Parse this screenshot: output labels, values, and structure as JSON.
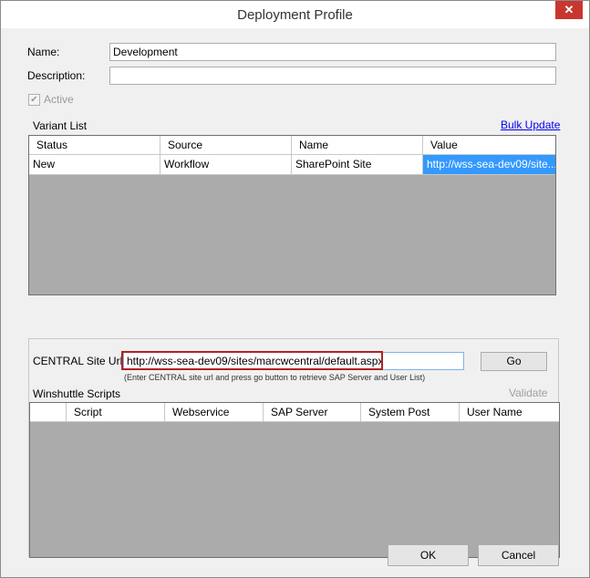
{
  "window": {
    "title": "Deployment Profile",
    "close_glyph": "✕"
  },
  "form": {
    "name_label": "Name:",
    "name_value": "Development",
    "description_label": "Description:",
    "description_value": "",
    "active_label": "Active",
    "active_checked": true,
    "check_glyph": "✔"
  },
  "variant_list": {
    "label": "Variant List",
    "bulk_update_label": "Bulk Update",
    "columns": [
      "Status",
      "Source",
      "Name",
      "Value"
    ],
    "rows": [
      {
        "status": "New",
        "source": "Workflow",
        "name": "SharePoint Site",
        "value": "http://wss-sea-dev09/site..."
      }
    ]
  },
  "central": {
    "site_url_label": "CENTRAL Site Url :",
    "site_url_value": "http://wss-sea-dev09/sites/marcwcentral/default.aspx",
    "hint": "(Enter CENTRAL site url and press go button to retrieve SAP Server and User List)",
    "go_label": "Go",
    "scripts_label": "Winshuttle Scripts",
    "validate_label": "Validate",
    "columns": [
      "",
      "Script",
      "Webservice",
      "SAP Server",
      "System Post",
      "User Name"
    ]
  },
  "buttons": {
    "ok": "OK",
    "cancel": "Cancel"
  },
  "colors": {
    "selection": "#3399ff",
    "grid_bg": "#ababab",
    "highlight_box": "#b22222",
    "link": "#0000ee"
  }
}
